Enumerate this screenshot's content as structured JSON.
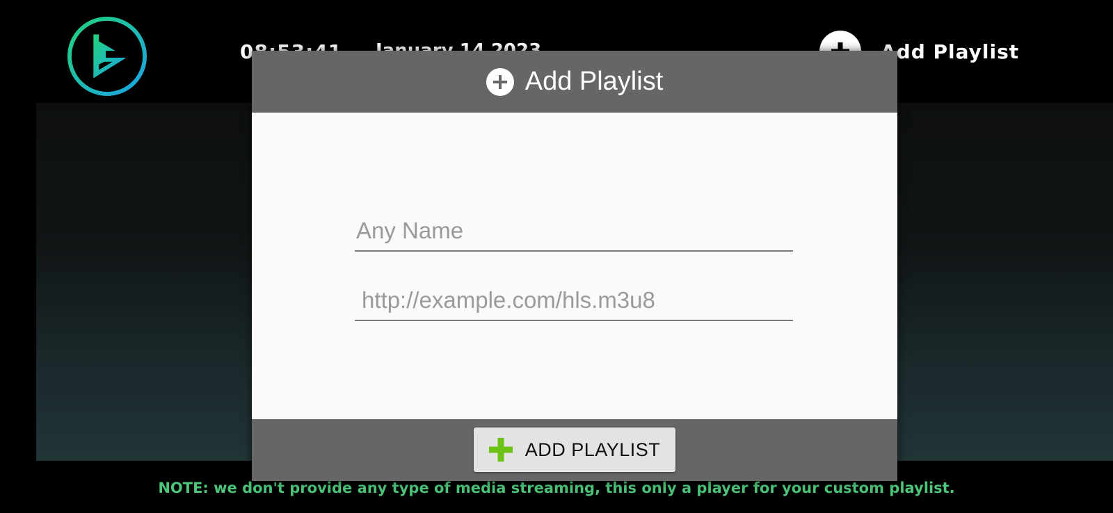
{
  "topbar": {
    "logo_icon": "play-logo-icon",
    "time": "08:53:41",
    "date": "January 14 2023",
    "add_playlist_label": "Add  Playlist",
    "add_icon": "plus-circle-icon"
  },
  "dialog": {
    "title": "Add Playlist",
    "title_icon": "plus-circle-icon",
    "name_field": {
      "placeholder": "Any Name",
      "value": ""
    },
    "url_field": {
      "placeholder": "http://example.com/hls.m3u8",
      "value": ""
    },
    "submit_label": "ADD PLAYLIST",
    "submit_icon": "green-plus-icon"
  },
  "note": "NOTE: we don't provide any type of media streaming, this only a player for your custom playlist.",
  "colors": {
    "dialog_header": "#666666",
    "note_text": "#4cc47a",
    "plus_green": "#6cc217",
    "logo_gradient_start": "#22d37a",
    "logo_gradient_end": "#1aa3e8"
  }
}
